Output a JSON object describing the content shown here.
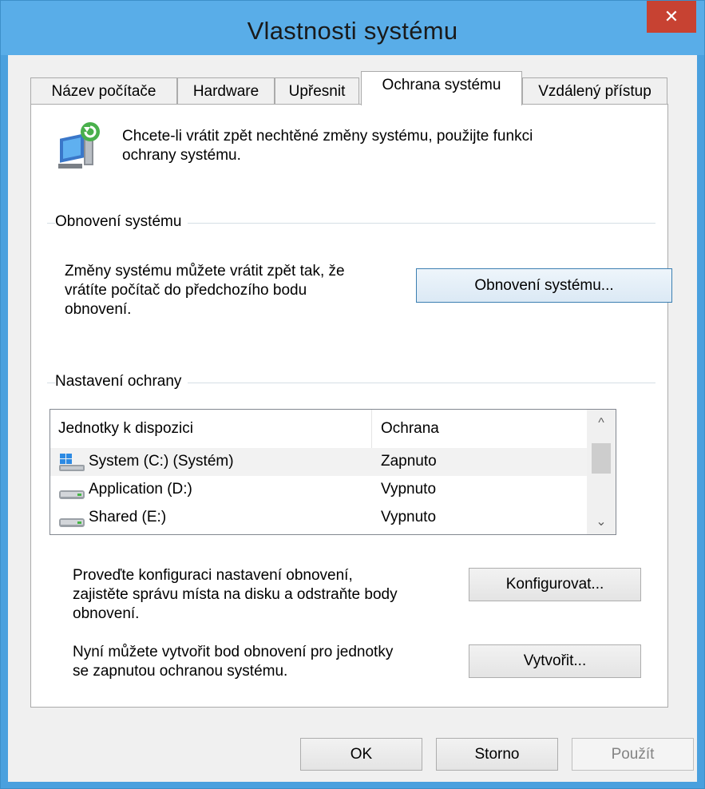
{
  "window": {
    "title": "Vlastnosti systému",
    "close_glyph": "✕"
  },
  "tabs": [
    {
      "label": "Název počítače"
    },
    {
      "label": "Hardware"
    },
    {
      "label": "Upřesnit"
    },
    {
      "label": "Ochrana systému",
      "active": true
    },
    {
      "label": "Vzdálený přístup"
    }
  ],
  "intro": {
    "icon": "system-protection-icon",
    "line1": "Chcete-li vrátit zpět nechtěné změny systému, použijte funkci",
    "line2": "ochrany systému."
  },
  "restore_group": {
    "label": "Obnovení systému",
    "desc_line1": "Změny systému můžete vrátit zpět tak, že",
    "desc_line2": "vrátíte počítač do předchozího bodu",
    "desc_line3": "obnovení.",
    "button": "Obnovení systému..."
  },
  "protection_group": {
    "label": "Nastavení ochrany",
    "columns": [
      "Jednotky k dispozici",
      "Ochrana"
    ],
    "drives": [
      {
        "name": "System (C:) (Systém)",
        "protection": "Zapnuto",
        "icon": "windows-drive-icon",
        "selected": true
      },
      {
        "name": "Application (D:)",
        "protection": "Vypnuto",
        "icon": "hard-drive-icon"
      },
      {
        "name": "Shared (E:)",
        "protection": "Vypnuto",
        "icon": "hard-drive-icon"
      }
    ],
    "scroll_up": "^",
    "scroll_down": "⌄"
  },
  "configure": {
    "desc_line1": "Proveďte konfiguraci nastavení obnovení,",
    "desc_line2": "zajistěte správu místa na disku a odstraňte body",
    "desc_line3": "obnovení.",
    "button": "Konfigurovat..."
  },
  "create": {
    "desc_line1": "Nyní můžete vytvořit bod obnovení pro jednotky",
    "desc_line2": "se zapnutou ochranou systému.",
    "button": "Vytvořit..."
  },
  "footer": {
    "ok": "OK",
    "cancel": "Storno",
    "apply": "Použít"
  },
  "colors": {
    "titlebar": "#59ade8",
    "close": "#c74232",
    "dialog_bg": "#f0f0f0"
  }
}
